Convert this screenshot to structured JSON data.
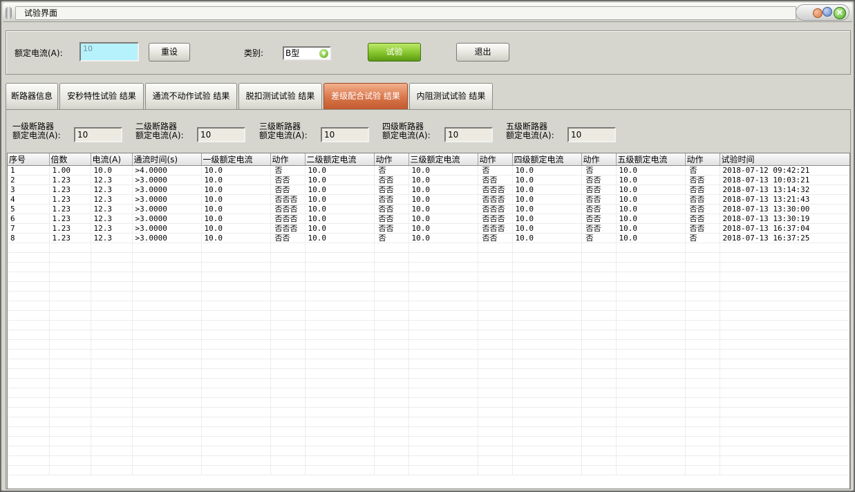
{
  "window": {
    "title": "试验界面"
  },
  "controls": {
    "rated_current_label": "额定电流(A):",
    "rated_current_value": "10",
    "reset_label": "重设",
    "category_label": "类别:",
    "category_value": "B型",
    "test_label": "试验",
    "exit_label": "退出"
  },
  "tabs": [
    {
      "label": "断路器信息"
    },
    {
      "label": "安秒特性试验 结果"
    },
    {
      "label": "通流不动作试验 结果"
    },
    {
      "label": "脱扣测试试验 结果"
    },
    {
      "label": "差级配合试验 结果",
      "active": true
    },
    {
      "label": "内阻测试试验 结果"
    }
  ],
  "levels": [
    {
      "line1": "一级断路器",
      "line2": "额定电流(A):",
      "value": "10"
    },
    {
      "line1": "二级断路器",
      "line2": "额定电流(A):",
      "value": "10"
    },
    {
      "line1": "三级断路器",
      "line2": "额定电流(A):",
      "value": "10"
    },
    {
      "line1": "四级断路器",
      "line2": "额定电流(A):",
      "value": "10"
    },
    {
      "line1": "五级断路器",
      "line2": "额定电流(A):",
      "value": "10"
    }
  ],
  "table": {
    "columns": [
      "序号",
      "倍数",
      "电流(A)",
      "通流时间(s)",
      "一级额定电流",
      "动作",
      "二级额定电流",
      "动作",
      "三级额定电流",
      "动作",
      "四级额定电流",
      "动作",
      "五级额定电流",
      "动作",
      "试验时间"
    ],
    "rows": [
      [
        "1",
        "1.00",
        "10.0",
        ">4.0000",
        "10.0",
        "否",
        "10.0",
        "否",
        "10.0",
        "否",
        "10.0",
        "否",
        "10.0",
        "否",
        "2018-07-12 09:42:21"
      ],
      [
        "2",
        "1.23",
        "12.3",
        ">3.0000",
        "10.0",
        "否否",
        "10.0",
        "否否",
        "10.0",
        "否否",
        "10.0",
        "否否",
        "10.0",
        "否否",
        "2018-07-13 10:03:21"
      ],
      [
        "3",
        "1.23",
        "12.3",
        ">3.0000",
        "10.0",
        "否否",
        "10.0",
        "否否",
        "10.0",
        "否否否",
        "10.0",
        "否否",
        "10.0",
        "否否",
        "2018-07-13 13:14:32"
      ],
      [
        "4",
        "1.23",
        "12.3",
        ">3.0000",
        "10.0",
        "否否否",
        "10.0",
        "否否",
        "10.0",
        "否否否",
        "10.0",
        "否否",
        "10.0",
        "否否",
        "2018-07-13 13:21:43"
      ],
      [
        "5",
        "1.23",
        "12.3",
        ">3.0000",
        "10.0",
        "否否否",
        "10.0",
        "否否",
        "10.0",
        "否否否",
        "10.0",
        "否否",
        "10.0",
        "否否",
        "2018-07-13 13:30:00"
      ],
      [
        "6",
        "1.23",
        "12.3",
        ">3.0000",
        "10.0",
        "否否否",
        "10.0",
        "否否",
        "10.0",
        "否否否",
        "10.0",
        "否否",
        "10.0",
        "否否",
        "2018-07-13 13:30:19"
      ],
      [
        "7",
        "1.23",
        "12.3",
        ">3.0000",
        "10.0",
        "否否否",
        "10.0",
        "否否",
        "10.0",
        "否否否",
        "10.0",
        "否否",
        "10.0",
        "否否",
        "2018-07-13 16:37:04"
      ],
      [
        "8",
        "1.23",
        "12.3",
        ">3.0000",
        "10.0",
        "否否",
        "10.0",
        "否",
        "10.0",
        "否否",
        "10.0",
        "否",
        "10.0",
        "否",
        "2018-07-13 16:37:25"
      ]
    ]
  }
}
